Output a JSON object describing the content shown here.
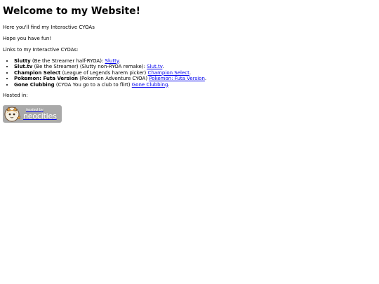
{
  "page": {
    "title": "Welcome to my Website!",
    "intro": "Here you'll find my Interactive CYOAs",
    "greeting": "Hope you have fun!",
    "links_heading": "Links to my Interactive CYOAs:",
    "hosted_in": "Hosted in:"
  },
  "cyoas": [
    {
      "name": "Slutty",
      "desc": " (Be the Streamer half-RYOA): ",
      "link": "Slutty",
      "after": "."
    },
    {
      "name": "Slut.tv",
      "desc": " (Be the Streamer) (Slutty non-RYOA remake): ",
      "link": "Slut.tv",
      "after": "."
    },
    {
      "name": "Champion Select",
      "desc": " (League of Legends harem picker) ",
      "link": "Champion Select",
      "after": "."
    },
    {
      "name": "Pokemon: Futa Version",
      "desc": " (Pokemon Adventure CYOA) ",
      "link": "Pokemon: Futa Version",
      "after": "."
    },
    {
      "name": "Gone Clubbing",
      "desc": " (CYOA You go to a club to flirt) ",
      "link": "Gone Clubbing",
      "after": "."
    }
  ],
  "badge": {
    "small": "hosted by",
    "big": "neocities",
    "icon": "neocities-cat-logo",
    "bg_color": "#a9a9a9"
  }
}
